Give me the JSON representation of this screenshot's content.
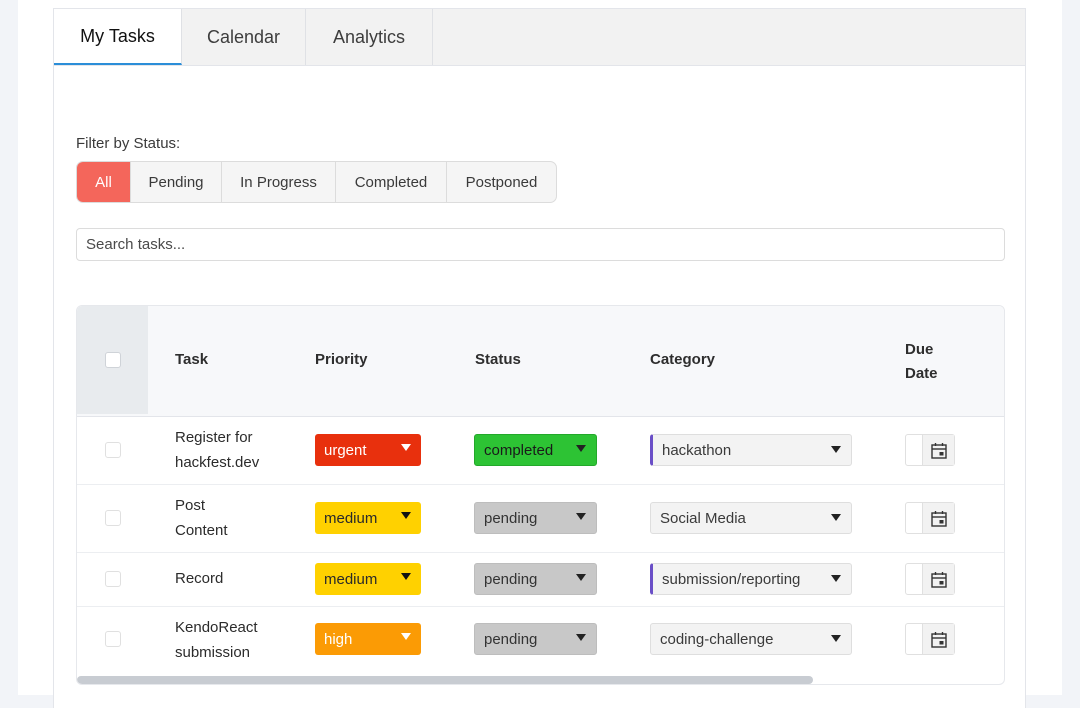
{
  "tabs": [
    {
      "label": "My Tasks",
      "active": true
    },
    {
      "label": "Calendar",
      "active": false
    },
    {
      "label": "Analytics",
      "active": false
    }
  ],
  "filter": {
    "label": "Filter by Status:",
    "options": [
      "All",
      "Pending",
      "In Progress",
      "Completed",
      "Postponed"
    ],
    "selected": "All"
  },
  "search": {
    "placeholder": "Search tasks...",
    "value": ""
  },
  "grid": {
    "columns": [
      "Task",
      "Priority",
      "Status",
      "Category",
      "Due Date"
    ],
    "rows": [
      {
        "task": "Register for hackfest.dev",
        "priority": "urgent",
        "status": "completed",
        "category": "hackathon",
        "due_date": ""
      },
      {
        "task": "Post Content",
        "priority": "medium",
        "status": "pending",
        "category": "Social Media",
        "due_date": ""
      },
      {
        "task": "Record",
        "priority": "medium",
        "status": "pending",
        "category": "submission/reporting",
        "due_date": ""
      },
      {
        "task": "KendoReact submission",
        "priority": "high",
        "status": "pending",
        "category": "coding-challenge",
        "due_date": ""
      }
    ]
  },
  "colors": {
    "accent_filter": "#f4665b",
    "tab_underline": "#2b8ed8",
    "priority_urgent": "#e8300d",
    "priority_medium": "#ffd100",
    "priority_high": "#fb9b05",
    "status_completed": "#2dc334",
    "status_pending": "#c8c8c8",
    "category_marker": "#6a4fc7"
  },
  "icons": {
    "date_picker": "calendar-icon",
    "dropdown": "chevron-down-icon"
  }
}
